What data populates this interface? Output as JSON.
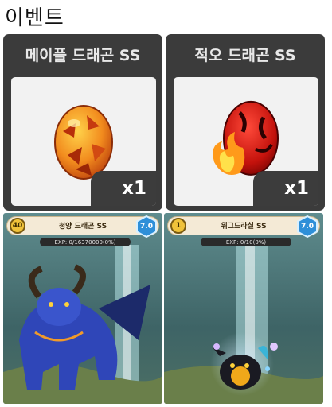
{
  "heading": "이벤트",
  "eggs": [
    {
      "title": "메이플 드래곤 SS",
      "quantity": "x1",
      "icon": "maple-dragon-egg"
    },
    {
      "title": "적오 드래곤 SS",
      "quantity": "x1",
      "icon": "fire-dragon-egg"
    }
  ],
  "dragons": [
    {
      "level": "40",
      "name": "청양 드래곤 SS",
      "grade": "7.0",
      "exp": "EXP: 0/16370000(0%)",
      "exp_fraction": 0,
      "icon": "blue-dragon"
    },
    {
      "level": "1",
      "name": "위그드라실 SS",
      "grade": "7.0",
      "exp": "EXP: 0/10(0%)",
      "exp_fraction": 0,
      "icon": "baby-dark-dragon"
    }
  ],
  "colors": {
    "card_bg": "#3b3b3b",
    "level_badge": "#f0c23a",
    "grade_badge": "#2e8fd8"
  }
}
